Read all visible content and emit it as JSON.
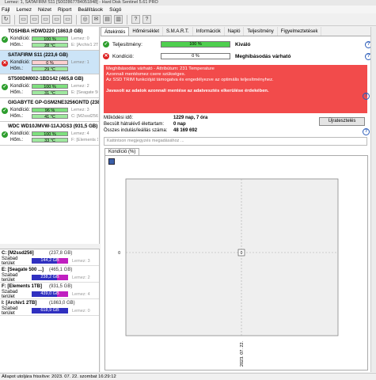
{
  "window": {
    "title": "Lemez: 1, SATAFIRM   S11 [S002867784051848] - Hard Disk Sentinel 5.61 PRO"
  },
  "menu": [
    "Fájl",
    "Lemez",
    "Nézet",
    "Riport",
    "Beállítások",
    "Súgó"
  ],
  "disks": [
    {
      "name": "TOSHIBA HDWD220 (1863,0 GB)",
      "health": "100 %",
      "temp": "28 °C",
      "extra1": "Lemez: 0",
      "extra2": "E: [Archiv1 2TB]",
      "status": "ok",
      "selected": false
    },
    {
      "name": "SATAFIRM   S11 (223,6 GB)",
      "health": "0 %",
      "temp": "29 °C",
      "extra1": "Lemez: 1",
      "extra2": "",
      "status": "bad",
      "selected": true
    },
    {
      "name": "ST500DM002-1BD142 (465,8 GB)",
      "health": "100 %",
      "temp": "31 °C",
      "extra1": "Lemez: 2",
      "extra2": "E: [Seagate 500]",
      "status": "ok",
      "selected": false
    },
    {
      "name": "GIGABYTE GP-GSM2NE3256GNTD (238,5 GB)",
      "health": "96 %",
      "temp": "41 °C",
      "extra1": "Lemez: 3",
      "extra2": "C: [M2ssd256]",
      "status": "ok",
      "selected": false
    },
    {
      "name": "WDC WD10JMVW-11AJGS3 (931,5 GB)",
      "health": "100 %",
      "temp": "33 °C",
      "extra1": "Lemez: 4",
      "extra2": "F: [Elements 1TB]",
      "status": "ok",
      "selected": false
    }
  ],
  "labels": {
    "condition": "Kondíció:",
    "temp": "Hőm.:",
    "free_space": "Szabad terület"
  },
  "volumes": [
    {
      "name": "C: [M2ssd256]",
      "size": "(237,8 GB)",
      "free": "144,2 GB",
      "disk": "Lemez: 3"
    },
    {
      "name": "E: [Seagate 500 ...]",
      "size": "(465,1 GB)",
      "free": "238,2 GB",
      "disk": "Lemez: 2"
    },
    {
      "name": "F: [Elements 1TB]",
      "size": "(931,5 GB)",
      "free": "439,0 GB",
      "disk": "Lemez: 4"
    },
    {
      "name": "I: [Archiv1 2TB]",
      "size": "(1863,0 GB)",
      "free": "618,9 GB",
      "disk": "Lemez: 0"
    }
  ],
  "tabs": [
    "Áttekintés",
    "Hőmérséklet",
    "S.M.A.R.T.",
    "Információk",
    "Napló",
    "Teljesítmény",
    "Figyelmeztetések"
  ],
  "overview": {
    "performance_label": "Teljesítmény:",
    "performance_value": "100 %",
    "performance_text": "Kiváló",
    "condition_label": "Kondíció:",
    "condition_value": "0 %",
    "condition_text": "Meghibásodás várható"
  },
  "alert": {
    "line1": "Meghibásodás várható - Attribútum: 231 Temperature",
    "line2": "Azonnali mentésmez csere szükséges.",
    "line3": "Az SSD TRIM funkcióját támogatva és engedélyezve az optimális teljesítményhez.",
    "bold": "Javasolt az adatok azonnali mentése az adatvesztés elkerülése érdekében."
  },
  "stats": [
    {
      "key": "Működési idő:",
      "val": "1229 nap, 7 óra"
    },
    {
      "key": "Becsült hátralévő élettartam:",
      "val": "0 nap"
    },
    {
      "key": "Összes indulás/leállás száma:",
      "val": "48 169 692"
    }
  ],
  "refresh_button": "Újratesztelés",
  "comment_placeholder": "Kattintson megjegyzés megadásához ...",
  "chart_tab": "Kondíció  (%)",
  "chart_data": {
    "type": "scatter",
    "x": [
      "2023. 07. 22."
    ],
    "y": [
      0
    ],
    "ylabel": "0",
    "point_label": "0"
  },
  "statusbar": "Állapot utoljára frissítve: 2023. 07. 22. szombat 16:29:12"
}
